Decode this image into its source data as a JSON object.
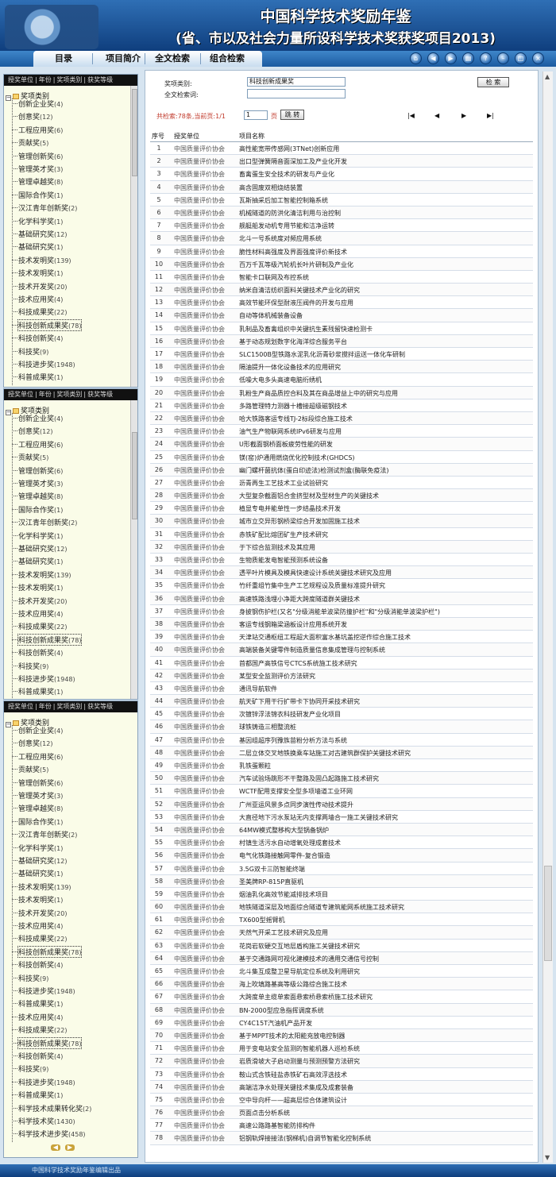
{
  "header": {
    "title_line1": "中国科学技术奖励年鉴",
    "title_line2": "(省、市以及社会力量所设科学技术奖获奖项目2013)"
  },
  "nav": {
    "tabs": [
      "目录",
      "项目简介",
      "全文检索",
      "组合检索"
    ],
    "icons": [
      "home-icon",
      "back-icon",
      "forward-icon",
      "print-icon",
      "help-icon",
      "minimize-icon",
      "maximize-icon",
      "close-icon"
    ]
  },
  "sidebar": {
    "head": [
      "授奖单位",
      "年份",
      "奖项类别",
      "获奖等级"
    ],
    "root": "奖项类别",
    "items": [
      {
        "label": "创新企业奖",
        "count": "(4)"
      },
      {
        "label": "创意奖",
        "count": "(12)"
      },
      {
        "label": "工程应用奖",
        "count": "(6)"
      },
      {
        "label": "贡献奖",
        "count": "(5)"
      },
      {
        "label": "管理创新奖",
        "count": "(6)"
      },
      {
        "label": "管理英才奖",
        "count": "(3)"
      },
      {
        "label": "管理卓越奖",
        "count": "(8)"
      },
      {
        "label": "国际合作奖",
        "count": "(1)"
      },
      {
        "label": "汉江青年创新奖",
        "count": "(2)"
      },
      {
        "label": "化学科学奖",
        "count": "(1)"
      },
      {
        "label": "基础研究奖",
        "count": "(12)"
      },
      {
        "label": "基础研究奖",
        "count": "(1)"
      },
      {
        "label": "技术发明奖",
        "count": "(139)"
      },
      {
        "label": "技术发明奖",
        "count": "(1)"
      },
      {
        "label": "技术开发奖",
        "count": "(20)"
      },
      {
        "label": "技术应用奖",
        "count": "(4)"
      },
      {
        "label": "科技成果奖",
        "count": "(22)"
      },
      {
        "label": "科技创新成果奖",
        "count": "(78)"
      },
      {
        "label": "科技创新奖",
        "count": "(4)"
      },
      {
        "label": "科技奖",
        "count": "(9)"
      },
      {
        "label": "科技进步奖",
        "count": "(1948)"
      },
      {
        "label": "科普成果奖",
        "count": "(1)"
      },
      {
        "label": "技术应用奖",
        "count": "(4)"
      },
      {
        "label": "科技成果奖",
        "count": "(22)"
      },
      {
        "label": "科技创新成果奖",
        "count": "(78)"
      },
      {
        "label": "科技创新奖",
        "count": "(4)"
      },
      {
        "label": "科技奖",
        "count": "(9)"
      },
      {
        "label": "科技进步奖",
        "count": "(1948)"
      },
      {
        "label": "科普成果奖",
        "count": "(1)"
      },
      {
        "label": "科学技术成果转化奖",
        "count": "(2)"
      },
      {
        "label": "科学技术奖",
        "count": "(1430)"
      },
      {
        "label": "科学技术进步奖",
        "count": "(458)"
      }
    ]
  },
  "search": {
    "award_type_label": "奖项类别:",
    "award_type_value": "科技创新成果奖",
    "fulltext_label": "全文检索词:",
    "fulltext_value": "",
    "search_button": "检 索"
  },
  "pager": {
    "total_label": "共检索:",
    "total_value": "78条",
    "current_label": ",当前页:",
    "current_value": "1/1",
    "page_input": "1",
    "page_unit": "页",
    "jump_button": "跳 转",
    "nav_glyphs": [
      "|◀",
      "◀",
      "▶",
      "▶|"
    ]
  },
  "table": {
    "headers": [
      "序号",
      "授奖单位",
      "项目名称"
    ],
    "rows": [
      [
        "1",
        "中国质量评价协会",
        "高性能宽带传感网(3TNet)创新应用"
      ],
      [
        "2",
        "中国质量评价协会",
        "出口型弹簧隔音面深加工及产业化开发"
      ],
      [
        "3",
        "中国质量评价协会",
        "畜禽蛋生安全技术的研发与产业化"
      ],
      [
        "4",
        "中国质量评价协会",
        "高含固废双相烧结装置"
      ],
      [
        "5",
        "中国质量评价协会",
        "瓦斯抽采后加工智能控制箱系统"
      ],
      [
        "6",
        "中国质量评价协会",
        "机械隧道的防洪化清洁利用与治控制"
      ],
      [
        "7",
        "中国质量评价协会",
        "舰艇船发动机专用节能和洁净运转"
      ],
      [
        "8",
        "中国质量评价协会",
        "北斗一号系统度对频应用系统"
      ],
      [
        "9",
        "中国质量评价协会",
        "脆性材料高强度及界面强度评价新技术"
      ],
      [
        "10",
        "中国质量评价协会",
        "百万千瓦等级汽轮机长叶片研制及产业化"
      ],
      [
        "11",
        "中国质量评价协会",
        "智能卡口联网及布控系统"
      ],
      [
        "12",
        "中国质量评价协会",
        "纳米自清洁纺织面料关键技术产业化的研究"
      ],
      [
        "13",
        "中国质量评价协会",
        "高效节能环保型耐液压阀件的开发与应用"
      ],
      [
        "14",
        "中国质量评价协会",
        "自动等体机械装备设备"
      ],
      [
        "15",
        "中国质量评价协会",
        "乳制品及畜禽组织中关键抗生素残留快速检测卡"
      ],
      [
        "16",
        "中国质量评价协会",
        "基于动态规划数字化海洋综合服务平台"
      ],
      [
        "17",
        "中国质量评价协会",
        "SLC1500B型铁路水泥乳化沥青砂浆搅拌运送一体化车研制"
      ],
      [
        "18",
        "中国质量评价协会",
        "隔油提升一体化设备技术的应用研究"
      ],
      [
        "19",
        "中国质量评价协会",
        "低噪大电多头高速电脑绗绣机"
      ],
      [
        "20",
        "中国质量评价协会",
        "乳粉生产商品质控合料及其在商品增益上中的研究与应用"
      ],
      [
        "21",
        "中国质量评价协会",
        "多路管理特力测器十槽接超级磁钢技术"
      ],
      [
        "22",
        "中国质量评价协会",
        "哈大铁路客运专线TJ-2标段综合施工技术"
      ],
      [
        "23",
        "中国质量评价协会",
        "油气生产物联网系统IPv6研发与应用"
      ],
      [
        "24",
        "中国质量评价协会",
        "U形截面钢桥面板疲劳性能的研发"
      ],
      [
        "25",
        "中国质量评价协会",
        "镁(窑)炉通用燃烧优化控制技术(GHDCS)"
      ],
      [
        "26",
        "中国质量评价协会",
        "幽门螺杆菌抗体(蛋白印迹法)检测试剂盒(酶联免疫法)"
      ],
      [
        "27",
        "中国质量评价协会",
        "沥青再生工艺技术工业试验研究"
      ],
      [
        "28",
        "中国质量评价协会",
        "大型复杂截面铝合金挤型材及型材生产的关键技术"
      ],
      [
        "29",
        "中国质量评价协会",
        "植显专电并能单性一步结晶技术开发"
      ],
      [
        "30",
        "中国质量评价协会",
        "城市立交异形钢桥梁综合开发加固施工技术"
      ],
      [
        "31",
        "中国质量评价协会",
        "赤铁矿配比熔团矿生产技术研究"
      ],
      [
        "32",
        "中国质量评价协会",
        "于下综合监测技术及其应用"
      ],
      [
        "33",
        "中国质量评价协会",
        "生物质能发电智能预测系统设备"
      ],
      [
        "34",
        "中国质量评价协会",
        "透平叶片模具及模具快速设计系统关键技术研究及应用"
      ],
      [
        "35",
        "中国质量评价协会",
        "竹纤重组竹集中生产工艺规程设及质量标准提升研究"
      ],
      [
        "36",
        "中国质量评价协会",
        "高速铁路浅埋小净距大跨度隧道群关键技术"
      ],
      [
        "37",
        "中国质量评价协会",
        "身披钢伤护栏(又名\"分级消能单波梁防撞护栏\"和\"分级消能单波梁护栏\")"
      ],
      [
        "38",
        "中国质量评价协会",
        "客运专线钢箱梁涵板设计应用系统开发"
      ],
      [
        "39",
        "中国质量评价协会",
        "天津站交通枢纽工程超大面积富水基坑盖挖逆作综合施工技术"
      ],
      [
        "40",
        "中国质量评价协会",
        "高端装备关键零件制造质量信息集成管理与控制系统"
      ],
      [
        "41",
        "中国质量评价协会",
        "首都国产高铁信号CTCS系统施工技术研究"
      ],
      [
        "42",
        "中国质量评价协会",
        "某型安全监测评价方法研究"
      ],
      [
        "43",
        "中国质量评价协会",
        "通讯导航软件"
      ],
      [
        "44",
        "中国质量评价协会",
        "航天矿下用干行扩带卡下协同开采技术研究"
      ],
      [
        "45",
        "中国质量评价协会",
        "次镀锌浮法锦衣科技研发产业化项目"
      ],
      [
        "46",
        "中国质量评价协会",
        "球铁铸造三相整流桩"
      ],
      [
        "47",
        "中国质量评价协会",
        "基因组超序列豫族苗粉分析方法与系统"
      ],
      [
        "48",
        "中国质量评价协会",
        "二层立体交叉地铁换乘车站施工对古建筑群保护关键技术研究"
      ],
      [
        "49",
        "中国质量评价协会",
        "乳铁蛋颗粒"
      ],
      [
        "50",
        "中国质量评价协会",
        "汽车试验场跳形不干整路及固凸起路施工技术研究"
      ],
      [
        "51",
        "中国质量评价协会",
        "WCTF配用支撑安全型多项墙道工业环网"
      ],
      [
        "52",
        "中国质量评价协会",
        "广州亚运风景多点同步演性传动技术提升"
      ],
      [
        "53",
        "中国质量评价协会",
        "大直径地下污水泵站无内支撑两墙合一施工关键技术研究"
      ],
      [
        "54",
        "中国质量评价协会",
        "64MW模式整移构大型锅备锅炉"
      ],
      [
        "55",
        "中国质量评价协会",
        "村镇生活污水自动增氧处理成套技术"
      ],
      [
        "56",
        "中国质量评价协会",
        "电气化铁路接触网零件-复合锻造"
      ],
      [
        "57",
        "中国质量评价协会",
        "3.5G双卡三防智能终端"
      ],
      [
        "58",
        "中国质量评价协会",
        "圣美牌RP-815P直驱机"
      ],
      [
        "59",
        "中国质量评价协会",
        "烟油乳化高效节能减排技术项目"
      ],
      [
        "60",
        "中国质量评价协会",
        "地铁隧道深层及地面综合隧道专建筑能网系统施工技术研究"
      ],
      [
        "61",
        "中国质量评价协会",
        "TX600型摇臂机"
      ],
      [
        "62",
        "中国质量评价协会",
        "天然气开采工艺技术研究及应用"
      ],
      [
        "63",
        "中国质量评价协会",
        "花岗岩软硬交互地层盾构施工关键技术研究"
      ],
      [
        "64",
        "中国质量评价协会",
        "基于交通路网可视化建模技术的通用交通信号控制"
      ],
      [
        "65",
        "中国质量评价协会",
        "北斗集互成整卫星导航定位系统及利用研究"
      ],
      [
        "66",
        "中国质量评价协会",
        "海上吹填路基高等级公路综合施工技术"
      ],
      [
        "67",
        "中国质量评价协会",
        "大跨度单主缆单索面悬索桥悬索桥施工技术研究"
      ],
      [
        "68",
        "中国质量评价协会",
        "BN-2000型应急指挥调度系统"
      ],
      [
        "69",
        "中国质量评价协会",
        "CY4C15T汽油机产品开发"
      ],
      [
        "70",
        "中国质量评价协会",
        "基于MPPT技术的太阳能充放电控制器"
      ],
      [
        "71",
        "中国质量评价协会",
        "用于变电站安全监测的智能机器人巡检系统"
      ],
      [
        "72",
        "中国质量评价协会",
        "岩质滑坡大子启动测量与预测预警方法研究"
      ],
      [
        "73",
        "中国质量评价协会",
        "鞍山式含铁硅盐赤铁矿石高效浮选技术"
      ],
      [
        "74",
        "中国质量评价协会",
        "高端洁净水处理关键技术集成及成套装备"
      ],
      [
        "75",
        "中国质量评价协会",
        "空中导向杆——超高层综合体建筑设计"
      ],
      [
        "76",
        "中国质量评价协会",
        "页面点击分析系统"
      ],
      [
        "77",
        "中国质量评价协会",
        "高速公路路基智能防排构件"
      ],
      [
        "78",
        "中国质量评价协会",
        "铝钢轨焊接接法(钢梯机)自调节智能化控制系统"
      ]
    ]
  },
  "footer": {
    "text": "中国科学技术奖励年鉴编辑出品"
  },
  "colors": {
    "header": "#1b5aa0",
    "sidebar_bg": "#fafce8",
    "pager_red": "#c0392b"
  }
}
